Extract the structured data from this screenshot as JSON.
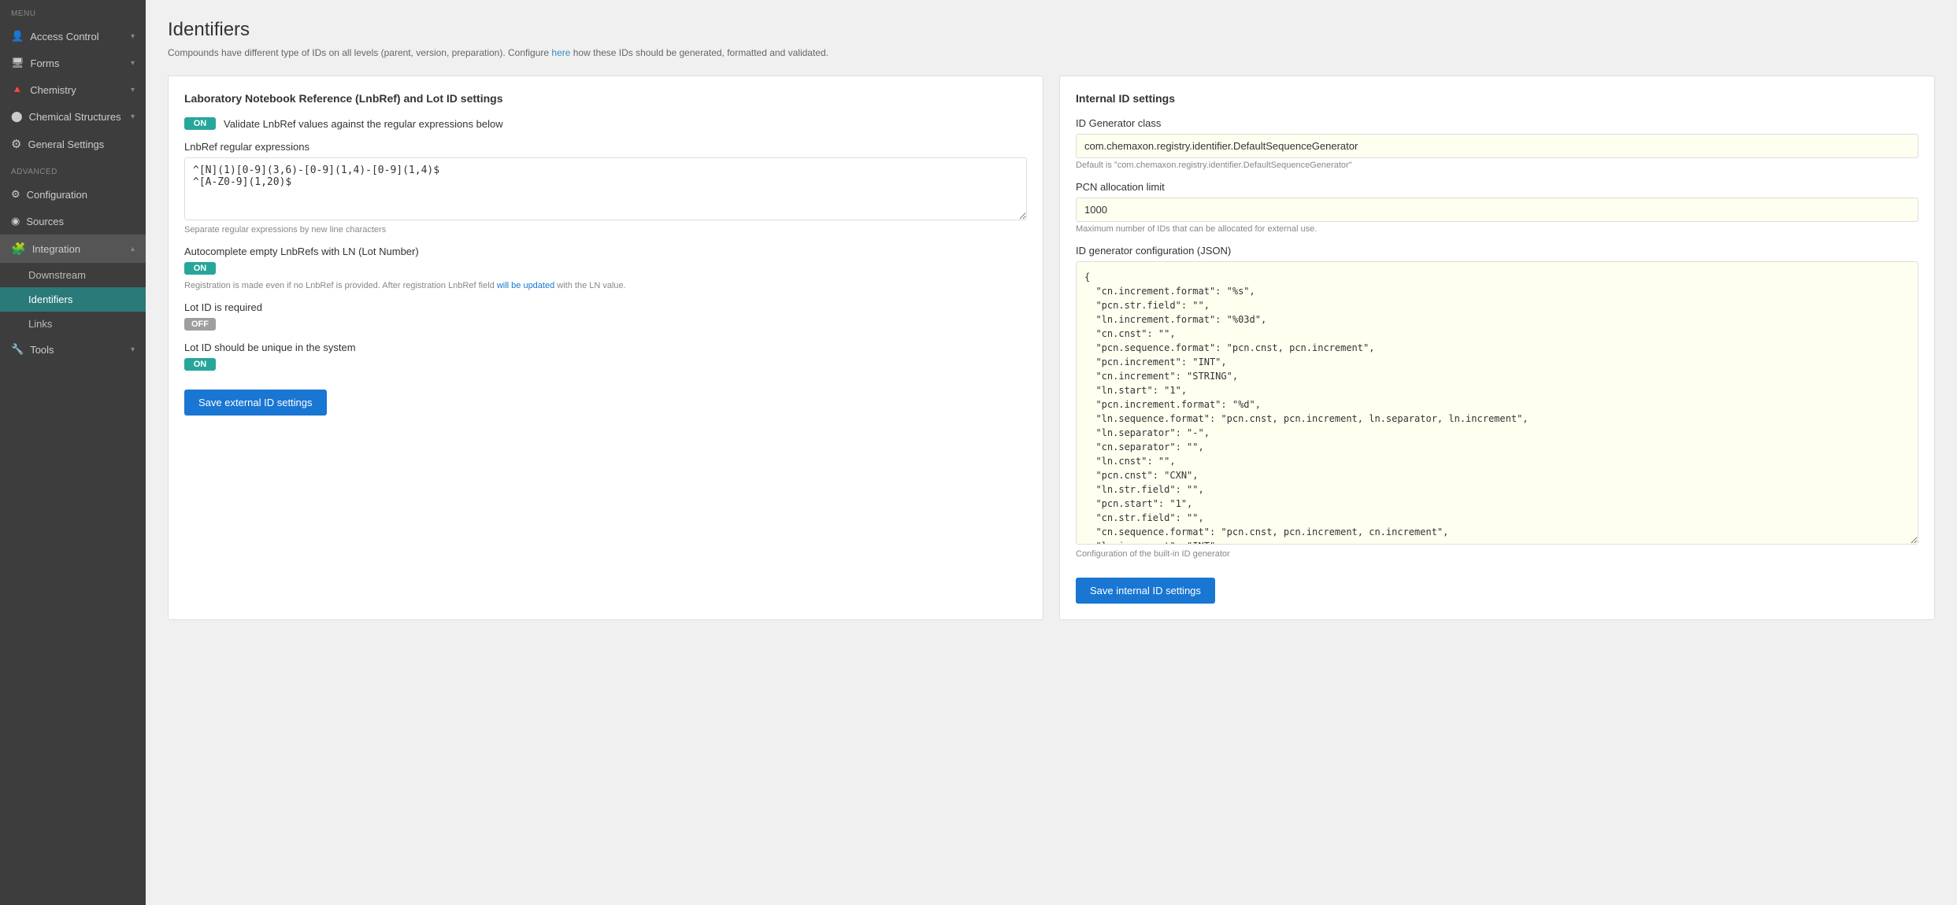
{
  "sidebar": {
    "menu_label": "MENU",
    "advanced_label": "ADVANCED",
    "items": [
      {
        "id": "access-control",
        "label": "Access Control",
        "icon": "person",
        "hasChevron": true
      },
      {
        "id": "forms",
        "label": "Forms",
        "icon": "square",
        "hasChevron": true
      },
      {
        "id": "chemistry",
        "label": "Chemistry",
        "icon": "tri",
        "hasChevron": true
      },
      {
        "id": "chemical-structures",
        "label": "Chemical Structures",
        "icon": "circle",
        "hasChevron": true
      },
      {
        "id": "general-settings",
        "label": "General Settings",
        "icon": "gear",
        "hasChevron": false
      }
    ],
    "advanced_items": [
      {
        "id": "configuration",
        "label": "Configuration",
        "icon": "wrench"
      },
      {
        "id": "sources",
        "label": "Sources",
        "icon": "circle"
      }
    ],
    "integration": {
      "label": "Integration",
      "icon": "puzzle",
      "sub_items": [
        {
          "id": "downstream",
          "label": "Downstream"
        },
        {
          "id": "identifiers",
          "label": "Identifiers",
          "active": true
        },
        {
          "id": "links",
          "label": "Links"
        }
      ]
    },
    "tools": {
      "label": "Tools",
      "icon": "wrench",
      "hasChevron": true
    }
  },
  "page": {
    "title": "Identifiers",
    "subtitle": "Compounds have different type of IDs on all levels (parent, version, preparation). Configure ",
    "subtitle_link": "here",
    "subtitle_end": " how these IDs should be generated, formatted and validated."
  },
  "left_card": {
    "title": "Laboratory Notebook Reference (LnbRef) and Lot ID settings",
    "validate_label": "Validate LnbRef values against the regular expressions below",
    "validate_toggle": "ON",
    "lnbref_label": "LnbRef regular expressions",
    "lnbref_value": "^[N](1)[0-9](3,6)-[0-9](1,4)-[0-9](1,4)$\n^[A-Z0-9](1,20)$",
    "lnbref_hint": "Separate regular expressions by new line characters",
    "autocomplete_label": "Autocomplete empty LnbRefs with LN (Lot Number)",
    "autocomplete_toggle": "ON",
    "autocomplete_hint": "Registration is made even if no LnbRef is provided. After registration LnbRef field ",
    "autocomplete_hint_link": "will be updated",
    "autocomplete_hint_end": " with the LN value.",
    "lot_required_label": "Lot ID is required",
    "lot_required_toggle": "OFF",
    "lot_unique_label": "Lot ID should be unique in the system",
    "lot_unique_toggle": "ON",
    "save_button": "Save external ID settings"
  },
  "right_card": {
    "title": "Internal ID settings",
    "id_generator_label": "ID Generator class",
    "id_generator_value": "com.chemaxon.registry.identifier.DefaultSequenceGenerator",
    "id_generator_hint": "Default is \"com.chemaxon.registry.identifier.DefaultSequenceGenerator\"",
    "pcn_limit_label": "PCN allocation limit",
    "pcn_limit_value": "1000",
    "pcn_limit_hint": "Maximum number of IDs that can be allocated for external use.",
    "json_config_label": "ID generator configuration (JSON)",
    "json_config_value": "{\n  \"cn.increment.format\": \"%s\",\n  \"pcn.str.field\": \"\",\n  \"ln.increment.format\": \"%03d\",\n  \"cn.cnst\": \"\",\n  \"pcn.sequence.format\": \"pcn.cnst, pcn.increment\",\n  \"pcn.increment\": \"INT\",\n  \"cn.increment\": \"STRING\",\n  \"ln.start\": \"1\",\n  \"pcn.increment.format\": \"%d\",\n  \"ln.sequence.format\": \"pcn.cnst, pcn.increment, ln.separator, ln.increment\",\n  \"ln.separator\": \"-\",\n  \"cn.separator\": \"\",\n  \"ln.cnst\": \"\",\n  \"pcn.cnst\": \"CXN\",\n  \"ln.str.field\": \"\",\n  \"pcn.start\": \"1\",\n  \"cn.str.field\": \"\",\n  \"cn.sequence.format\": \"pcn.cnst, pcn.increment, cn.increment\",\n  \"ln.increment\": \"INT\",\n  \"cn.start\": \"A\",\n  \"pcn.separator\": \"\"\n}",
    "json_config_hint": "Configuration of the built-in ID generator",
    "save_button": "Save internal ID settings"
  }
}
